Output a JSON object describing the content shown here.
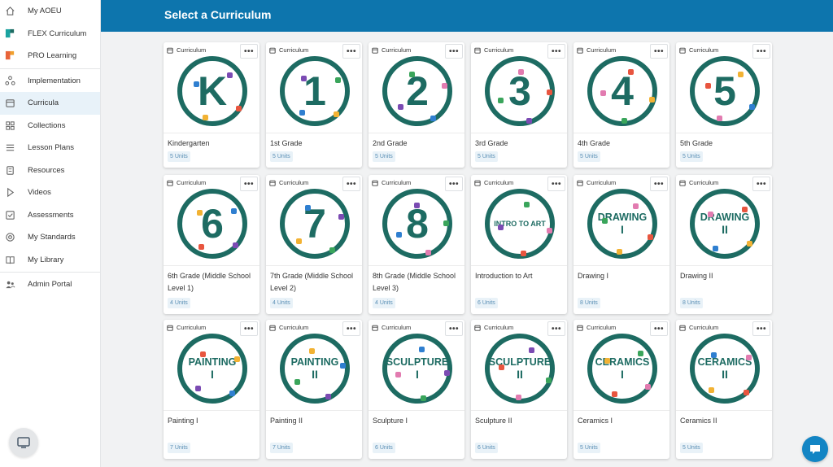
{
  "sidebar": {
    "items": [
      {
        "label": "My AOEU",
        "icon": "home-icon"
      },
      {
        "label": "FLEX Curriculum",
        "icon": "flex-logo-icon"
      },
      {
        "label": "PRO Learning",
        "icon": "pro-logo-icon"
      },
      {
        "label": "Implementation",
        "icon": "implementation-icon"
      },
      {
        "label": "Curricula",
        "icon": "calendar-icon",
        "active": true
      },
      {
        "label": "Collections",
        "icon": "collections-icon"
      },
      {
        "label": "Lesson Plans",
        "icon": "list-icon"
      },
      {
        "label": "Resources",
        "icon": "document-icon"
      },
      {
        "label": "Videos",
        "icon": "play-icon"
      },
      {
        "label": "Assessments",
        "icon": "checkbox-icon"
      },
      {
        "label": "My Standards",
        "icon": "target-icon"
      },
      {
        "label": "My Library",
        "icon": "book-icon"
      },
      {
        "label": "Admin Portal",
        "icon": "users-icon"
      }
    ]
  },
  "header": {
    "title": "Select a Curriculum"
  },
  "badge_label": "Curriculum",
  "more_label": "•••",
  "colors": {
    "header": "#0d75ad",
    "emblem": "#1d6b62",
    "accent": "#1385c4"
  },
  "cards": [
    {
      "title": "Kindergarten",
      "units": "5 Units",
      "emblem": "K"
    },
    {
      "title": "1st Grade",
      "units": "5 Units",
      "emblem": "1"
    },
    {
      "title": "2nd Grade",
      "units": "5 Units",
      "emblem": "2"
    },
    {
      "title": "3rd Grade",
      "units": "5 Units",
      "emblem": "3"
    },
    {
      "title": "4th Grade",
      "units": "5 Units",
      "emblem": "4"
    },
    {
      "title": "5th Grade",
      "units": "5 Units",
      "emblem": "5"
    },
    {
      "title": "6th Grade (Middle School Level 1)",
      "units": "4 Units",
      "emblem": "6"
    },
    {
      "title": "7th Grade (Middle School Level 2)",
      "units": "4 Units",
      "emblem": "7"
    },
    {
      "title": "8th Grade (Middle School Level 3)",
      "units": "4 Units",
      "emblem": "8"
    },
    {
      "title": "Introduction to Art",
      "units": "6 Units",
      "emblem": "INTRO TO ART"
    },
    {
      "title": "Drawing I",
      "units": "8 Units",
      "emblem": "DRAWING",
      "roman": "I"
    },
    {
      "title": "Drawing II",
      "units": "8 Units",
      "emblem": "DRAWING",
      "roman": "II"
    },
    {
      "title": "Painting I",
      "units": "7 Units",
      "emblem": "PAINTING",
      "roman": "I"
    },
    {
      "title": "Painting II",
      "units": "7 Units",
      "emblem": "PAINTING",
      "roman": "II"
    },
    {
      "title": "Sculpture I",
      "units": "6 Units",
      "emblem": "SCULPTURE",
      "roman": "I"
    },
    {
      "title": "Sculpture II",
      "units": "6 Units",
      "emblem": "SCULPTURE",
      "roman": "II"
    },
    {
      "title": "Ceramics I",
      "units": "5 Units",
      "emblem": "CERAMICS",
      "roman": "I"
    },
    {
      "title": "Ceramics II",
      "units": "5 Units",
      "emblem": "CERAMICS",
      "roman": "II"
    }
  ]
}
